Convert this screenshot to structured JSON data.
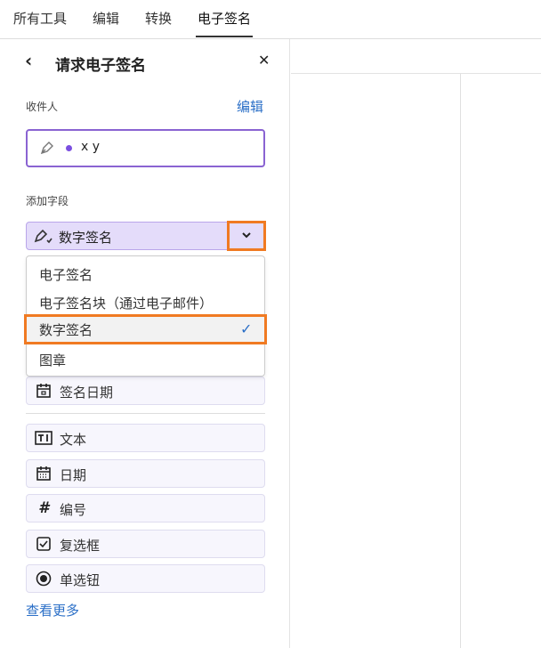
{
  "tabs": [
    "所有工具",
    "编辑",
    "转换",
    "电子签名"
  ],
  "panel": {
    "title": "请求电子签名",
    "recipients_label": "收件人",
    "edit_link": "编辑",
    "recipient": "x y",
    "add_fields_label": "添加字段",
    "selected_field": "数字签名",
    "menu_options": [
      "电子签名",
      "电子签名块（通过电子邮件）",
      "数字签名",
      "图章"
    ],
    "fields": [
      "签名日期",
      "文本",
      "日期",
      "编号",
      "复选框",
      "单选钮"
    ],
    "see_more": "查看更多"
  },
  "colors": {
    "accent": "#8a63d2",
    "highlight": "#f07a22",
    "link": "#2b6fc7"
  }
}
